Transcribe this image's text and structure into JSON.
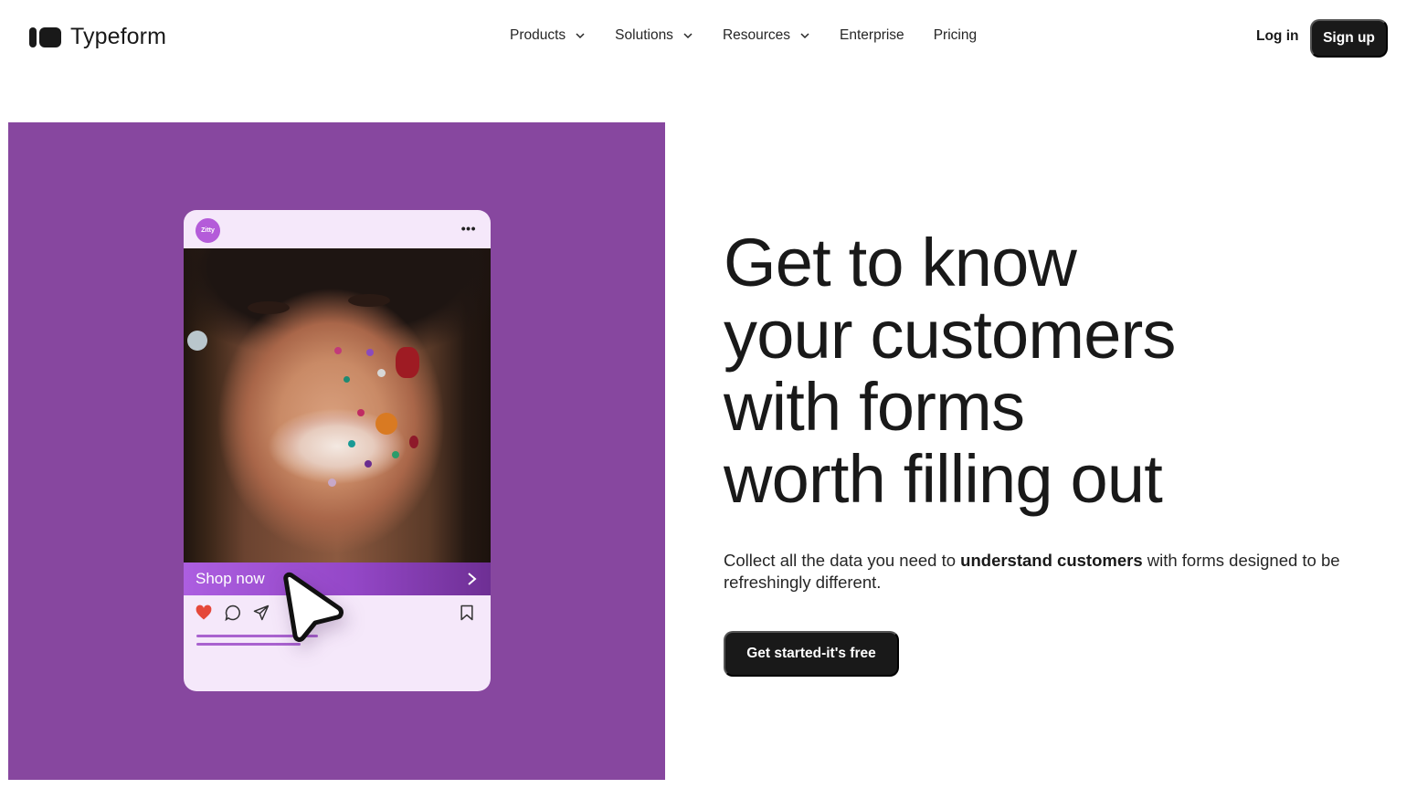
{
  "brand": {
    "name": "Typeform",
    "accent_purple": "#87479f",
    "dark": "#191919"
  },
  "nav": {
    "items": [
      {
        "label": "Products",
        "has_dropdown": true
      },
      {
        "label": "Solutions",
        "has_dropdown": true
      },
      {
        "label": "Resources",
        "has_dropdown": true
      },
      {
        "label": "Enterprise",
        "has_dropdown": false
      },
      {
        "label": "Pricing",
        "has_dropdown": false
      }
    ],
    "login_label": "Log in",
    "signup_label": "Sign up"
  },
  "hero": {
    "headline_lines": [
      "Get to know",
      "your customers",
      "with forms",
      "worth filling out"
    ],
    "subcopy_before": "Collect all the data you need to ",
    "subcopy_bold": "understand customers",
    "subcopy_after": " with forms designed to be refreshingly different.",
    "cta_label": "Get started-it's free"
  },
  "phone_mock": {
    "account_name": "Zitty",
    "more_icon": "more-horizontal-icon",
    "shop_label": "Shop now",
    "icons": [
      "heart-icon",
      "comment-icon",
      "send-icon",
      "bookmark-icon",
      "cursor-pointer-icon"
    ]
  }
}
